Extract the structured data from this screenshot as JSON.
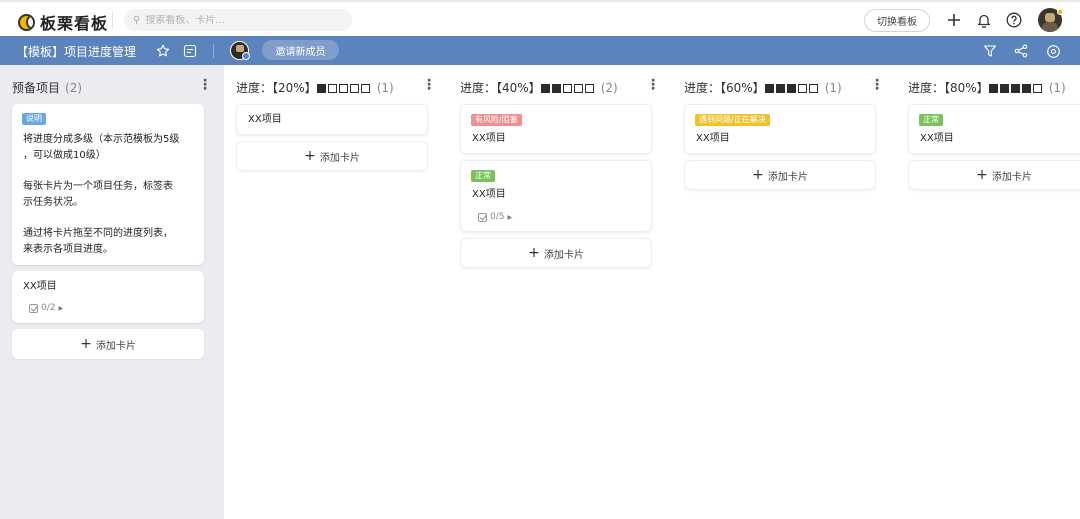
{
  "app": {
    "name": "板栗看板",
    "search_placeholder": "搜索看板、卡片...",
    "switch_board_label": "切换看板",
    "icons": [
      "plus-icon",
      "bell-icon",
      "help-icon"
    ]
  },
  "board": {
    "title": "【模板】项目进度管理",
    "invite_label": "邀请新成员",
    "header_color": "#5b83bd"
  },
  "columns": [
    {
      "name": "预备项目",
      "count": "(2)",
      "progress_filled": null,
      "cards": [
        {
          "tag": "说明",
          "tag_color": "#69a7e6",
          "lines": [
            "将进度分成多级（本示范模板为5级",
            "，可以做成10级）",
            "",
            "每张卡片为一个项目任务，标签表",
            "示任务状况。",
            "",
            "通过将卡片拖至不同的进度列表，",
            "来表示各项目进度。"
          ]
        },
        {
          "tag": null,
          "lines": [
            "XX项目"
          ],
          "checklist": "0/2"
        }
      ],
      "add_label": "添加卡片"
    },
    {
      "name": "进度：【20%】",
      "count": "(1)",
      "progress_filled": 1,
      "cards": [
        {
          "tag": null,
          "lines": [
            "XX项目"
          ]
        }
      ],
      "add_label": "添加卡片"
    },
    {
      "name": "进度：【40%】",
      "count": "(2)",
      "progress_filled": 2,
      "cards": [
        {
          "tag": "有风险/阻塞",
          "tag_color": "#ef8f8f",
          "lines": [
            "XX项目"
          ]
        },
        {
          "tag": "正常",
          "tag_color": "#7cc25a",
          "lines": [
            "XX项目"
          ],
          "checklist": "0/5"
        }
      ],
      "add_label": "添加卡片"
    },
    {
      "name": "进度：【60%】",
      "count": "(1)",
      "progress_filled": 3,
      "cards": [
        {
          "tag": "遇到问题/正在解决",
          "tag_color": "#f2c12e",
          "lines": [
            "XX项目"
          ]
        }
      ],
      "add_label": "添加卡片"
    },
    {
      "name": "进度：【80%】",
      "count": "(1)",
      "progress_filled": 4,
      "cards": [
        {
          "tag": "正常",
          "tag_color": "#7cc25a",
          "lines": [
            "XX项目"
          ]
        }
      ],
      "add_label": "添加卡片"
    }
  ]
}
